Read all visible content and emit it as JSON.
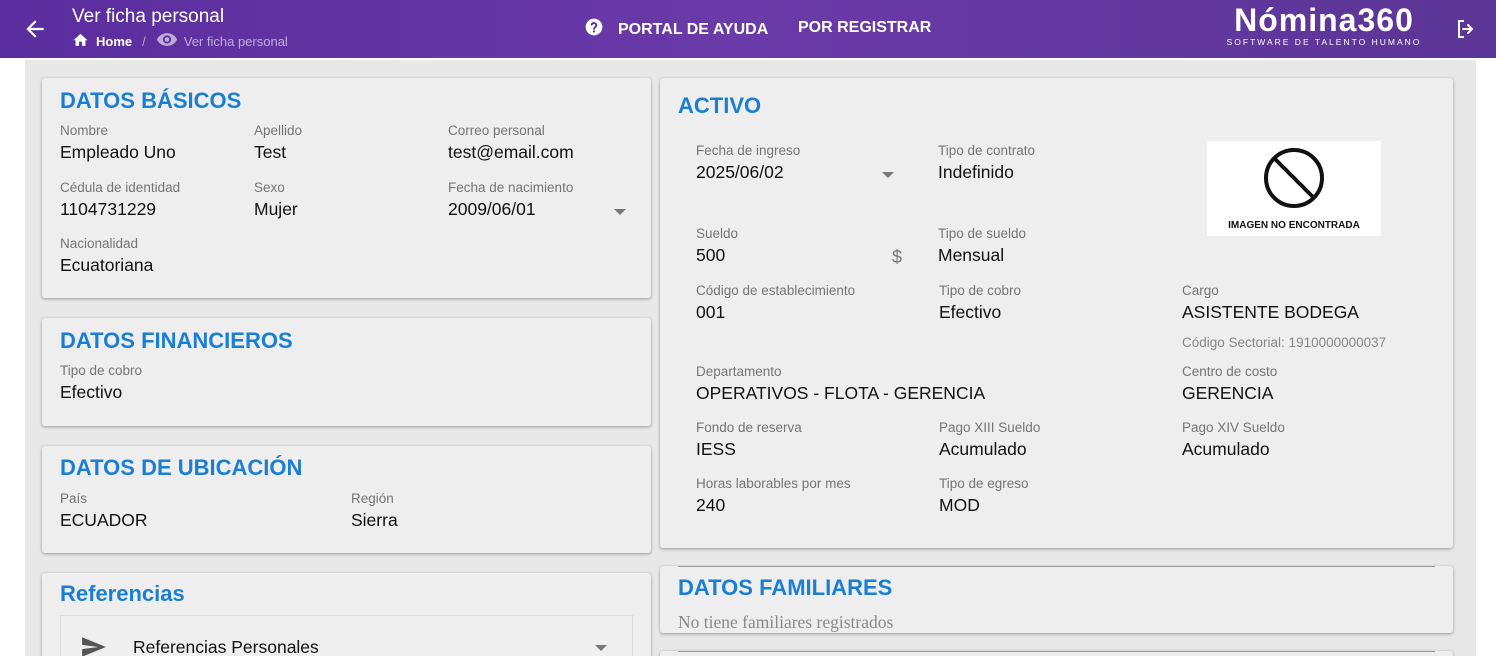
{
  "header": {
    "title": "Ver ficha personal",
    "breadcrumb_home": "Home",
    "breadcrumb_separator": "/",
    "breadcrumb_current": "Ver ficha personal",
    "nav_help": "PORTAL DE AYUDA",
    "nav_register": "POR REGISTRAR",
    "logo_main": "Nómina360",
    "logo_sub": "SOFTWARE DE TALENTO HUMANO"
  },
  "basic": {
    "title": "DATOS BÁSICOS",
    "nombre_label": "Nombre",
    "nombre": "Empleado Uno",
    "apellido_label": "Apellido",
    "apellido": "Test",
    "correo_label": "Correo personal",
    "correo": "test@email.com",
    "cedula_label": "Cédula de identidad",
    "cedula": "1104731229",
    "sexo_label": "Sexo",
    "sexo": "Mujer",
    "nacimiento_label": "Fecha de nacimiento",
    "nacimiento": "2009/06/01",
    "nacionalidad_label": "Nacionalidad",
    "nacionalidad": "Ecuatoriana"
  },
  "financial": {
    "title": "DATOS FINANCIEROS",
    "cobro_label": "Tipo de cobro",
    "cobro": "Efectivo"
  },
  "location": {
    "title": "DATOS DE UBICACIÓN",
    "pais_label": "País",
    "pais": "ECUADOR",
    "region_label": "Región",
    "region": "Sierra"
  },
  "references": {
    "title": "Referencias",
    "personal_label": "Referencias Personales"
  },
  "active": {
    "title": "ACTIVO",
    "ingreso_label": "Fecha de ingreso",
    "ingreso": "2025/06/02",
    "contrato_label": "Tipo de contrato",
    "contrato": "Indefinido",
    "image_text": "IMAGEN NO ENCONTRADA",
    "sueldo_label": "Sueldo",
    "sueldo": "500",
    "currency": "$",
    "tipo_sueldo_label": "Tipo de sueldo",
    "tipo_sueldo": "Mensual",
    "codigo_est_label": "Código de establecimiento",
    "codigo_est": "001",
    "tipo_cobro_label": "Tipo de cobro",
    "tipo_cobro": "Efectivo",
    "cargo_label": "Cargo",
    "cargo": "ASISTENTE BODEGA",
    "codigo_sectorial": "Código Sectorial: 1910000000037",
    "departamento_label": "Departamento",
    "departamento": "OPERATIVOS - FLOTA - GERENCIA",
    "centro_costo_label": "Centro de costo",
    "centro_costo": "GERENCIA",
    "fondo_label": "Fondo de reserva",
    "fondo": "IESS",
    "xiii_label": "Pago XIII Sueldo",
    "xiii": "Acumulado",
    "xiv_label": "Pago XIV Sueldo",
    "xiv": "Acumulado",
    "horas_label": "Horas laborables por mes",
    "horas": "240",
    "egreso_label": "Tipo de egreso",
    "egreso": "MOD"
  },
  "family": {
    "title": "DATOS FAMILIARES",
    "empty": "No tiene familiares registrados"
  },
  "icons": {
    "back": "arrow-left-icon",
    "home": "home-icon",
    "view": "eye-icon",
    "help": "help-circle-icon",
    "logout": "logout-icon",
    "send": "send-icon",
    "no_image": "no-image-icon"
  },
  "colors": {
    "header_bg": "#5a2d9e",
    "accent_title": "#1a7fd4",
    "card_bg": "#eeeeee",
    "content_bg": "#e8e8e8"
  }
}
